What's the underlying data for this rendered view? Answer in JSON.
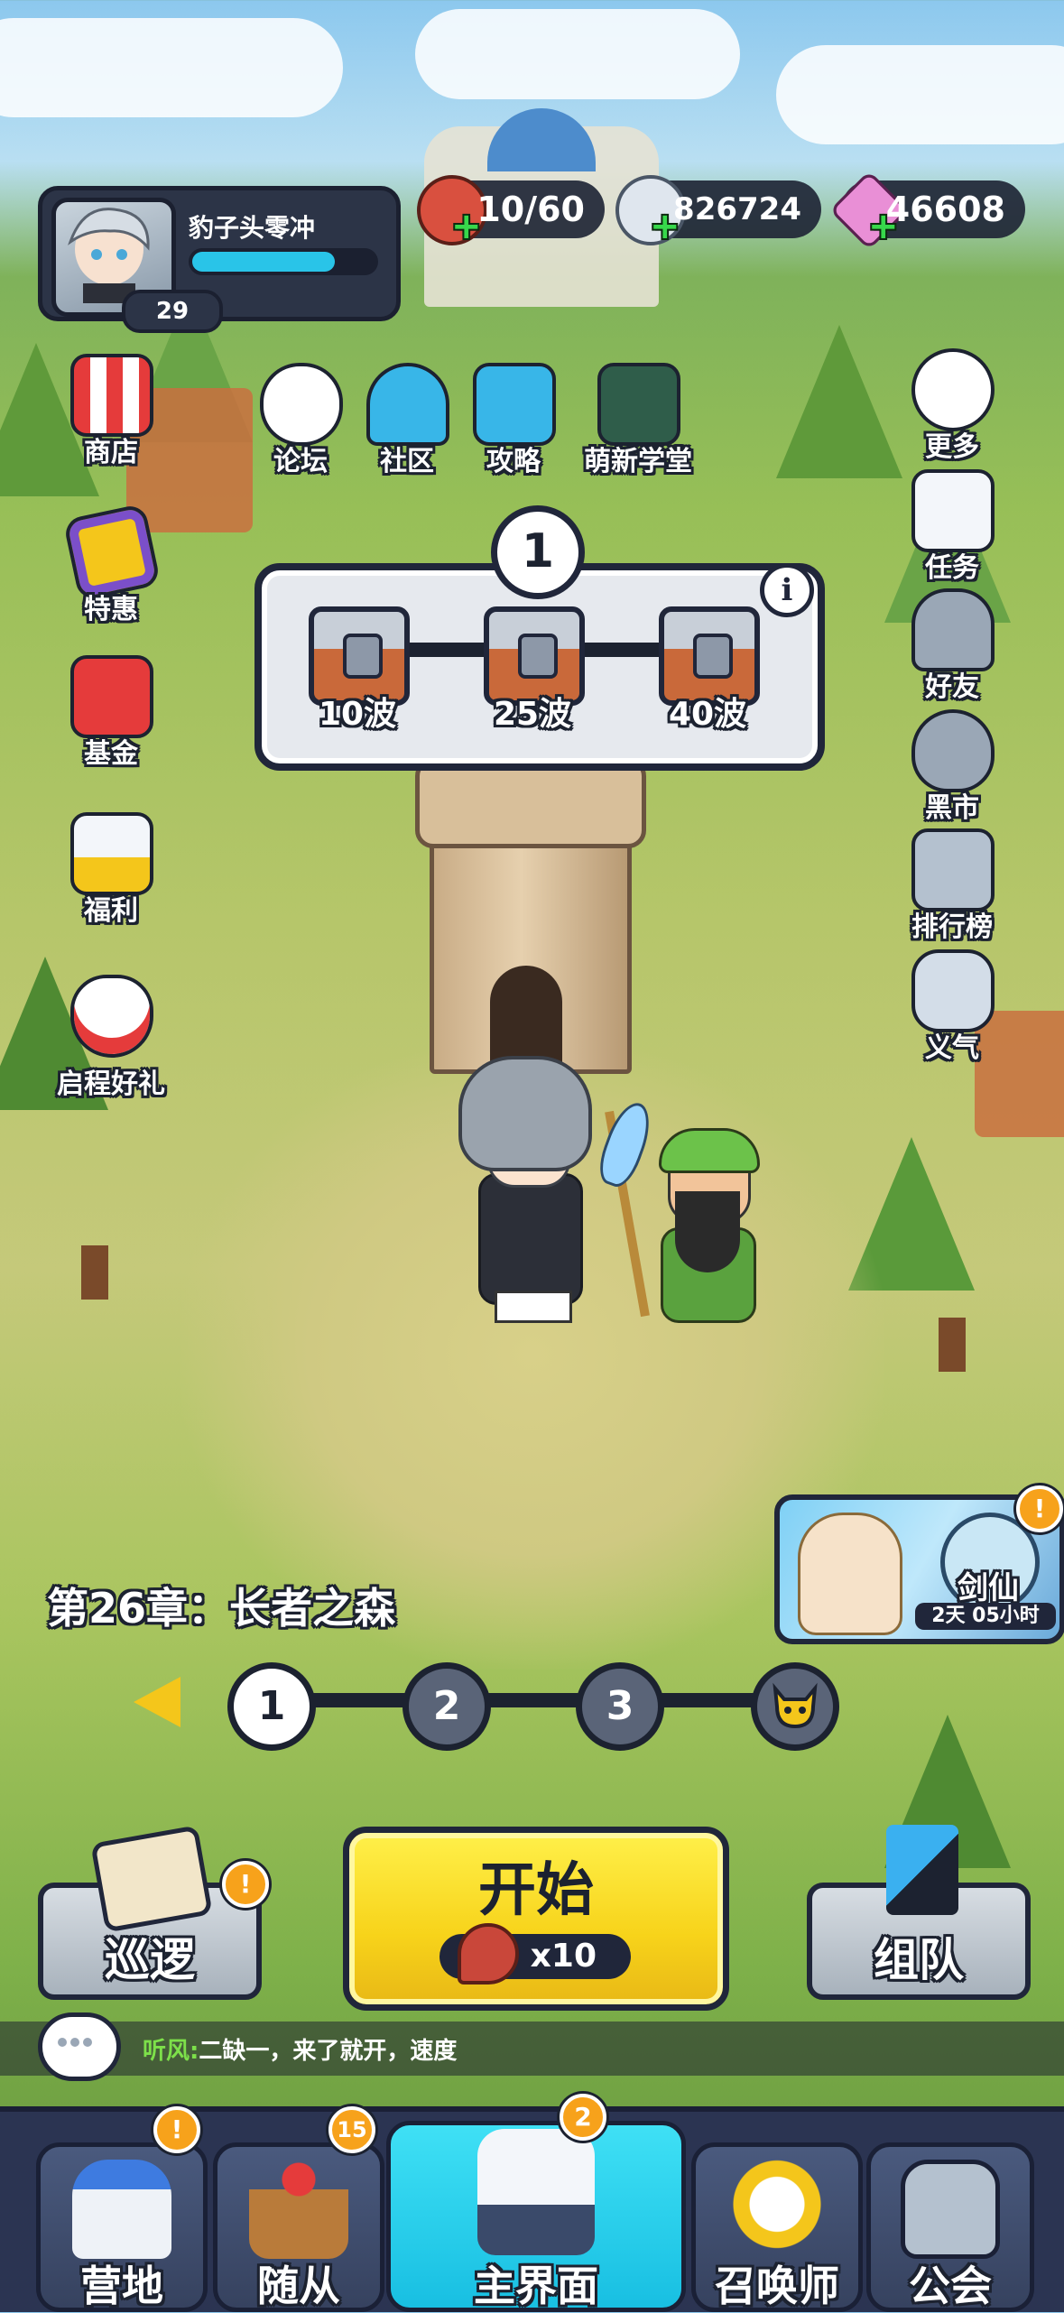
{
  "player": {
    "name": "豹子头零冲",
    "level": "29",
    "xp_fraction": 0.78
  },
  "resources": [
    {
      "id": "stamina",
      "icon": "meat-icon",
      "value": "10/60",
      "color": "#d9503f"
    },
    {
      "id": "coins",
      "icon": "silver-coin-icon",
      "value": "826724",
      "color": "#dfe6ee"
    },
    {
      "id": "gems",
      "icon": "diamond-icon",
      "value": "46608",
      "color": "#e98fd6"
    }
  ],
  "left_menu": {
    "shop": "商店",
    "special_offer": "特惠",
    "fund": "基金",
    "welfare": "福利",
    "journey_gift": "启程好礼"
  },
  "top_menu": {
    "forum": "论坛",
    "community": "社区",
    "guide": "攻略",
    "newbie_school": "萌新学堂"
  },
  "right_menu": {
    "more": "更多",
    "quests": "任务",
    "friends": "好友",
    "black_market": "黑市",
    "leaderboard": "排行榜",
    "loyalty": "义气"
  },
  "wave_panel": {
    "current": "1",
    "info": "i",
    "milestones": [
      "10波",
      "25波",
      "40波"
    ]
  },
  "event": {
    "title": "剑仙",
    "timer": "2天 05小时",
    "badge": "!"
  },
  "chapter": {
    "title": "第26章：长者之森",
    "stages": [
      "1",
      "2",
      "3"
    ],
    "current_stage": "1"
  },
  "actions": {
    "patrol": "巡逻",
    "patrol_badge": "!",
    "start": "开始",
    "start_cost": "x10",
    "team": "组队"
  },
  "chat": {
    "sender": "听风:",
    "message": "二缺一，来了就开，速度"
  },
  "bottom_nav": [
    {
      "label": "营地",
      "badge": "!",
      "icon": "castle-icon"
    },
    {
      "label": "随从",
      "badge": "15",
      "icon": "slingshot-icon"
    },
    {
      "label": "主界面",
      "badge": "2",
      "icon": "tower-icon",
      "active": true
    },
    {
      "label": "召唤师",
      "badge": "",
      "icon": "summon-hand-icon"
    },
    {
      "label": "公会",
      "badge": "",
      "icon": "lock-icon"
    }
  ],
  "colors": {
    "accent_yellow": "#f7d31a",
    "active_tab": "#18bfe2",
    "xp": "#29c4e8",
    "badge": "#f7a21b"
  }
}
